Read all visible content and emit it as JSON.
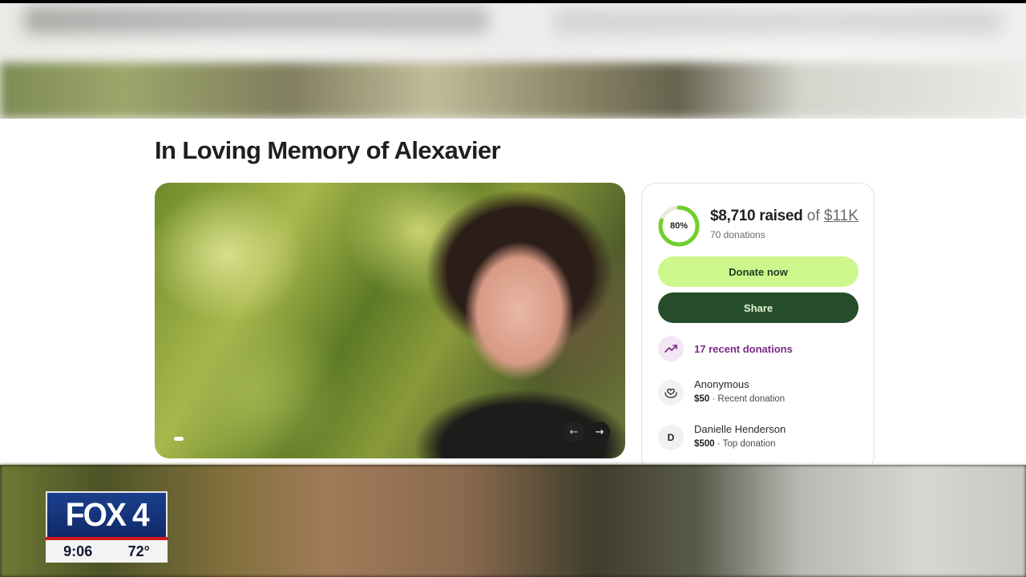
{
  "campaign": {
    "title": "In Loving Memory of Alexavier"
  },
  "fundraiser": {
    "progress_percent": 80,
    "progress_label": "80%",
    "raised_amount": "$8,710 raised",
    "goal_prefix": "of",
    "goal_amount": "$11K",
    "donation_count": "70 donations",
    "donate_label": "Donate now",
    "share_label": "Share",
    "recent_label": "17 recent donations",
    "accent_color": "#cdf68c",
    "share_color": "#264d2b",
    "ring_color": "#6fcf2b"
  },
  "donors": [
    {
      "name": "Anonymous",
      "amount": "$50",
      "note": " · Recent donation",
      "icon": "heart-hands-icon"
    },
    {
      "name": "Danielle Henderson",
      "initial": "D",
      "amount": "$500",
      "note": " · Top donation"
    }
  ],
  "broadcast": {
    "station": "FOX 4",
    "time": "9:06",
    "temperature": "72°"
  }
}
